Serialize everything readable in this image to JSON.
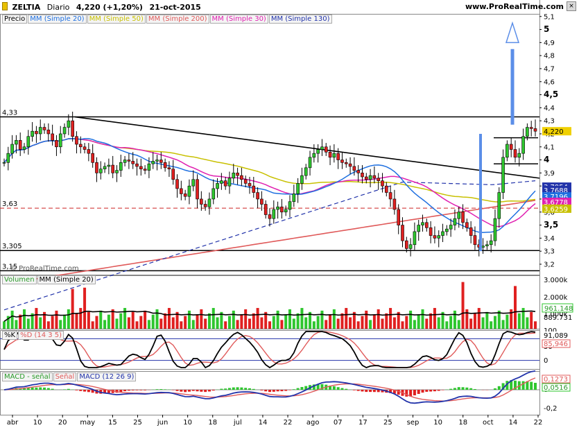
{
  "header": {
    "symbol": "ZELTIA",
    "period": "Diario",
    "quote": "4,220 (+1,20%)",
    "date": "21-oct-2015",
    "site": "www.ProRealTime.com",
    "watermark": "© ProRealTime.com"
  },
  "price_legend": [
    {
      "label": "Precio",
      "color": "#000000"
    },
    {
      "label": "MM (Simple 20)",
      "color": "#1e6fe0"
    },
    {
      "label": "MM (Simple 50)",
      "color": "#c8c000"
    },
    {
      "label": "MM (Simple 200)",
      "color": "#e05a5a"
    },
    {
      "label": "MM (Simple 30)",
      "color": "#e020b0"
    },
    {
      "label": "MM (Simple 130)",
      "color": "#2233aa"
    }
  ],
  "volume_legend": [
    {
      "label": "Volumen",
      "color": "#2a9a2a"
    },
    {
      "label": "MM (Simple 20)",
      "color": "#000000"
    }
  ],
  "stoch_legend": [
    {
      "label": "%K",
      "color": "#000000"
    },
    {
      "label": "%D (14 3 5)",
      "color": "#e05a5a"
    }
  ],
  "macd_legend": [
    {
      "label": "MACD - señal",
      "color": "#2a9a2a"
    },
    {
      "label": "Señal",
      "color": "#e05a5a"
    },
    {
      "label": "MACD (12 26 9)",
      "color": "#2233aa"
    }
  ],
  "chart_data": {
    "type": "candlestick",
    "price_axis": {
      "ylim": [
        3.12,
        5.12
      ],
      "ticks": [
        "5,1",
        "5",
        "4,9",
        "4,8",
        "4,7",
        "4,6",
        "4,5",
        "4,4",
        "4,3",
        "4,2",
        "4,1",
        "4",
        "3,9",
        "3,8",
        "3,7",
        "3,6",
        "3,5",
        "3,4",
        "3,3",
        "3,2"
      ],
      "bold_ticks": [
        "5",
        "4,5",
        "4",
        "3,5"
      ]
    },
    "time_axis": [
      "abr",
      "10",
      "20",
      "may",
      "15",
      "25",
      "jun",
      "10",
      "18",
      "jul",
      "14",
      "22",
      "ago",
      "07",
      "17",
      "25",
      "sep",
      "10",
      "18",
      "oct",
      "14",
      "22"
    ],
    "levels": [
      {
        "label": "4,33",
        "value": 4.33,
        "style": "solid",
        "color": "#000000"
      },
      {
        "label": "3,63",
        "value": 3.63,
        "style": "dashed",
        "color": "#cc2222"
      },
      {
        "label": "3,305",
        "value": 3.305,
        "style": "solid",
        "color": "#000000"
      },
      {
        "label": "3,15",
        "value": 3.15,
        "style": "solid",
        "color": "#000000"
      },
      {
        "label": "",
        "value": 4.17,
        "style": "short",
        "color": "#000000"
      },
      {
        "label": "",
        "value": 3.97,
        "style": "short",
        "color": "#000000"
      }
    ],
    "trendline": {
      "from": [
        "20",
        4.33
      ],
      "to": [
        "22",
        3.86
      ]
    },
    "price_badges": [
      {
        "label": "4,220",
        "value": 4.22,
        "color": "#f0d000",
        "text": "#000000"
      },
      {
        "label": "3,7954",
        "value": 3.795,
        "color": "#2233aa",
        "text": "#ffffff"
      },
      {
        "label": "3,7688",
        "value": 3.769,
        "color": "#2233aa",
        "text": "#ffffff"
      },
      {
        "label": "3,7196",
        "value": 3.72,
        "color": "#1e6fe0",
        "text": "#ffffff"
      },
      {
        "label": "3,6778",
        "value": 3.678,
        "color": "#e020b0",
        "text": "#ffffff"
      },
      {
        "label": "3,6259",
        "value": 3.626,
        "color": "#c8c000",
        "text": "#ffffff"
      }
    ],
    "closes": [
      3.98,
      4.05,
      4.12,
      4.15,
      4.08,
      4.1,
      4.18,
      4.22,
      4.2,
      4.25,
      4.23,
      4.2,
      4.15,
      4.1,
      4.2,
      4.25,
      4.3,
      4.18,
      4.12,
      4.1,
      4.08,
      4.05,
      3.98,
      3.9,
      3.93,
      3.95,
      3.96,
      3.9,
      3.92,
      3.98,
      4.0,
      3.99,
      3.97,
      3.95,
      3.93,
      3.92,
      3.97,
      3.99,
      4.0,
      3.98,
      3.94,
      3.93,
      3.85,
      3.78,
      3.74,
      3.72,
      3.8,
      3.85,
      3.7,
      3.66,
      3.64,
      3.7,
      3.78,
      3.82,
      3.84,
      3.8,
      3.86,
      3.9,
      3.88,
      3.85,
      3.82,
      3.8,
      3.75,
      3.7,
      3.66,
      3.58,
      3.55,
      3.62,
      3.64,
      3.6,
      3.62,
      3.68,
      3.74,
      3.82,
      3.88,
      3.94,
      4.02,
      4.05,
      4.08,
      4.1,
      4.06,
      4.02,
      4.05,
      4.0,
      3.98,
      3.97,
      3.95,
      3.92,
      3.9,
      3.87,
      3.85,
      3.88,
      3.86,
      3.84,
      3.8,
      3.75,
      3.7,
      3.62,
      3.5,
      3.38,
      3.32,
      3.35,
      3.45,
      3.5,
      3.52,
      3.48,
      3.42,
      3.4,
      3.42,
      3.45,
      3.47,
      3.5,
      3.55,
      3.6,
      3.52,
      3.48,
      3.42,
      3.35,
      3.33,
      3.34,
      3.35,
      3.38,
      3.55,
      3.75,
      4.02,
      4.12,
      4.08,
      4.02,
      4.05,
      4.18,
      4.25,
      4.24,
      4.22
    ]
  },
  "volume": {
    "ticks": [
      "3.000k",
      "2.000k",
      "1.000k"
    ],
    "ma_label": "961.148",
    "vol_label": "889.731",
    "ylim": [
      0,
      3600
    ]
  },
  "stochastic": {
    "ticks": [
      "100",
      "50",
      "0"
    ],
    "k_label": "91,089",
    "d_label": "85,946",
    "levels": [
      80,
      20
    ]
  },
  "macd": {
    "ticks": [
      "0",
      "-0,2"
    ],
    "macd_label": "0,1273",
    "signal_label": "0,0516"
  },
  "arrow": {
    "color": "#5b8ee8"
  }
}
